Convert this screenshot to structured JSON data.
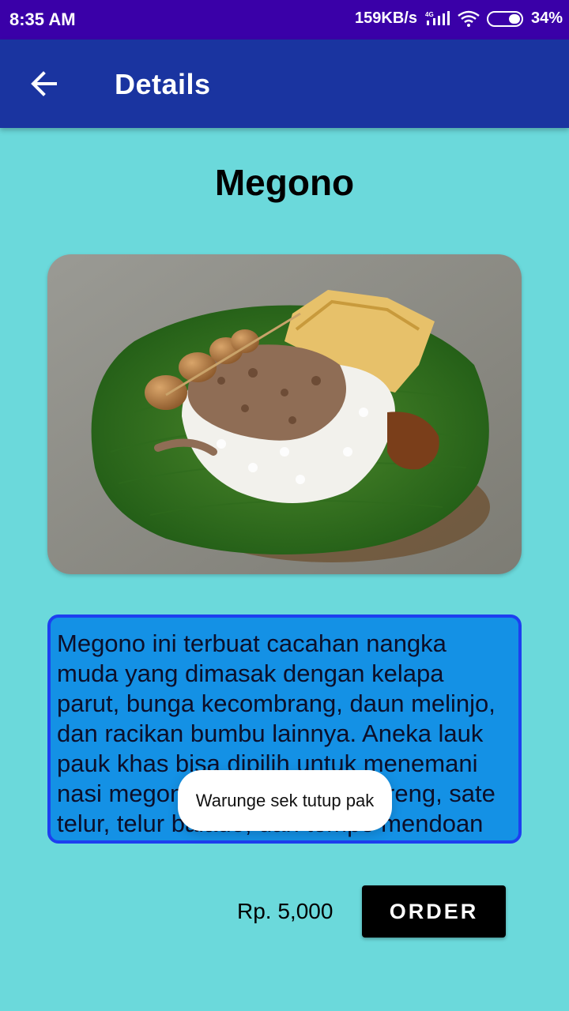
{
  "status_bar": {
    "time": "8:35 AM",
    "network_speed": "159KB/s",
    "network_type": "4G",
    "battery": "34%",
    "icons": [
      "signal-icon",
      "wifi-icon",
      "battery-icon"
    ]
  },
  "app_bar": {
    "title": "Details",
    "back_icon": "arrow-back-icon",
    "color": "#1a34a0"
  },
  "food": {
    "name": "Megono",
    "image_alt": "Megono dish on banana leaf",
    "description": "Megono ini terbuat cacahan nangka muda yang dimasak dengan kelapa parut, bunga kecombrang, daun melinjo, dan racikan bumbu lainnya. Aneka lauk pauk khas bisa dipilih untuk menemani nasi megono seperti tempe goreng, sate telur, telur balado, dan tempe mendoan",
    "price": "Rp. 5,000"
  },
  "actions": {
    "order_label": "ORDER"
  },
  "toast": {
    "message": "Warunge sek tutup pak"
  },
  "colors": {
    "background": "#6bd9db",
    "status_bar": "#3a00a8",
    "description_box": "#1491e5",
    "description_border": "#1d3ff0"
  }
}
